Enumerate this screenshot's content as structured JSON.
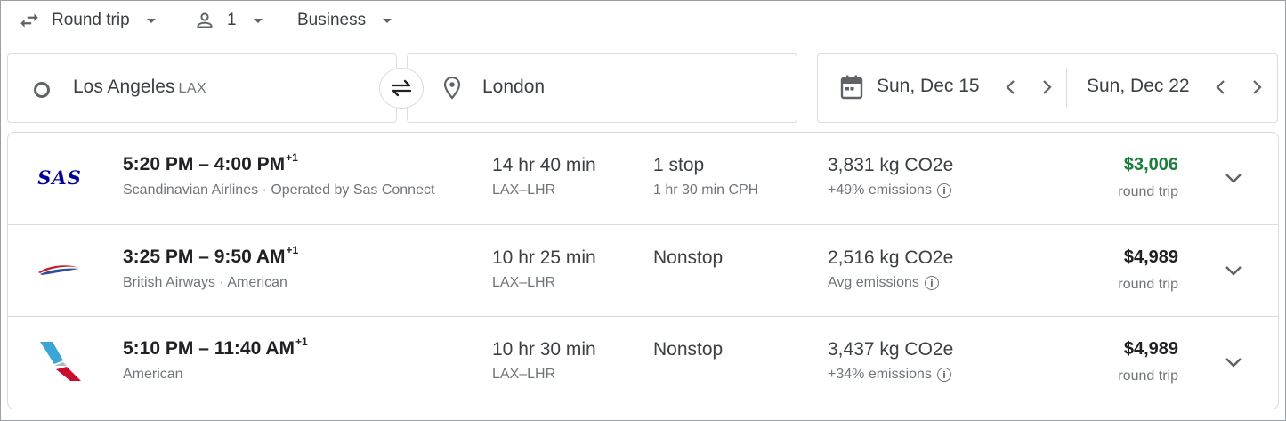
{
  "search": {
    "trip_type": "Round trip",
    "passengers": "1",
    "cabin": "Business",
    "origin": "Los Angeles",
    "origin_code": "LAX",
    "destination": "London",
    "depart_date": "Sun, Dec 15",
    "return_date": "Sun, Dec 22"
  },
  "icons": [
    "swap-horiz-icon",
    "person-icon",
    "caret-down-icon",
    "origin-circle-icon",
    "swap-icon",
    "location-pin-icon",
    "calendar-icon",
    "chevron-left-icon",
    "chevron-right-icon",
    "info-icon",
    "expand-icon"
  ],
  "colors": {
    "best_price": "#188038",
    "sas_blue": "#000099",
    "ba_red": "#c0202a",
    "ba_blue": "#2b4f9e",
    "aa_blue": "#3aa6d8",
    "aa_red": "#c8102e"
  },
  "flights": [
    {
      "depart": "5:20 PM",
      "arrive": "4:00 PM",
      "day_offset": "+1",
      "airline": "Scandinavian Airlines · Operated by Sas Connect",
      "duration": "14 hr 40 min",
      "route": "LAX–LHR",
      "stops": "1 stop",
      "layover": "1 hr 30 min CPH",
      "co2": "3,831 kg CO2e",
      "emissions": "+49% emissions",
      "price": "$3,006",
      "price_type": "round trip",
      "logo_text": "SAS"
    },
    {
      "depart": "3:25 PM",
      "arrive": "9:50 AM",
      "day_offset": "+1",
      "airline": "British Airways · American",
      "duration": "10 hr 25 min",
      "route": "LAX–LHR",
      "stops": "Nonstop",
      "layover": "",
      "co2": "2,516 kg CO2e",
      "emissions": "Avg emissions",
      "price": "$4,989",
      "price_type": "round trip"
    },
    {
      "depart": "5:10 PM",
      "arrive": "11:40 AM",
      "day_offset": "+1",
      "airline": "American",
      "duration": "10 hr 30 min",
      "route": "LAX–LHR",
      "stops": "Nonstop",
      "layover": "",
      "co2": "3,437 kg CO2e",
      "emissions": "+34% emissions",
      "price": "$4,989",
      "price_type": "round trip"
    }
  ]
}
